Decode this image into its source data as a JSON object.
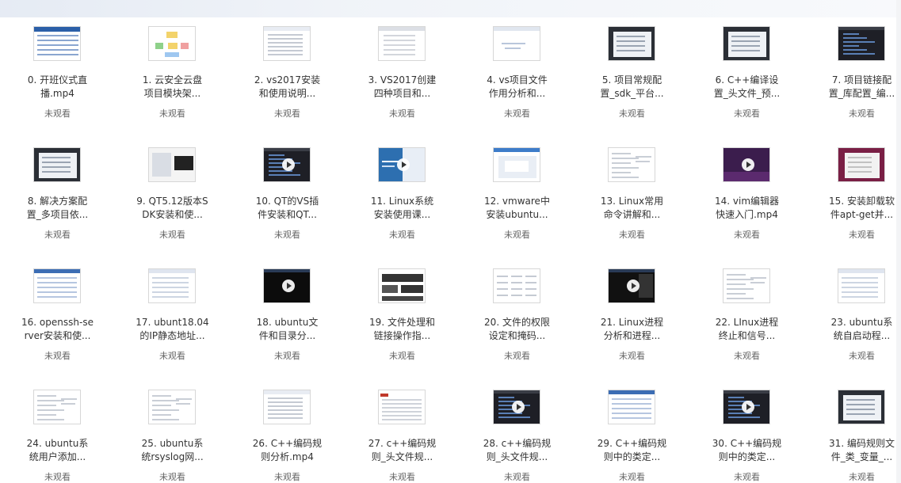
{
  "status_label": "未观看",
  "videos": [
    {
      "title": "0. 开班仪式直\n播.mp4",
      "thumb": "blue-table",
      "play": false
    },
    {
      "title": "1. 云安全云盘\n项目模块架...",
      "thumb": "diagram",
      "play": false
    },
    {
      "title": "2. vs2017安装\n和使用说明...",
      "thumb": "doc-list",
      "play": false
    },
    {
      "title": "3. VS2017创建\n四种项目和...",
      "thumb": "doc-gray",
      "play": false
    },
    {
      "title": "4. vs项目文件\n作用分析和...",
      "thumb": "doc-light",
      "play": false
    },
    {
      "title": "5. 项目常规配\n置_sdk_平台...",
      "thumb": "dialog-dark",
      "play": false
    },
    {
      "title": "6. C++编译设\n置_头文件_预...",
      "thumb": "dialog-dark",
      "play": false
    },
    {
      "title": "7. 项目链接配\n置_库配置_编...",
      "thumb": "ide-dark",
      "play": false
    },
    {
      "title": "8. 解决方案配\n置_多项目依...",
      "thumb": "dialog-dark",
      "play": false
    },
    {
      "title": "9. QT5.12版本S\nDK安装和使...",
      "thumb": "installer",
      "play": false
    },
    {
      "title": "10. QT的VS插\n件安装和QT...",
      "thumb": "ide-dark",
      "play": true
    },
    {
      "title": "11. Linux系统\n安装使用课...",
      "thumb": "slide-blue",
      "play": true
    },
    {
      "title": "12. vmware中\n安装ubuntu...",
      "thumb": "vmware",
      "play": false
    },
    {
      "title": "13. Linux常用\n命令讲解和...",
      "thumb": "doc-text",
      "play": false
    },
    {
      "title": "14. vim编辑器\n快速入门.mp4",
      "thumb": "purple",
      "play": true
    },
    {
      "title": "15. 安装卸载软\n件apt-get并...",
      "thumb": "ubuntu",
      "play": false
    },
    {
      "title": "16. openssh-se\nrver安装和使...",
      "thumb": "web-blue",
      "play": false
    },
    {
      "title": "17. ubunt18.04\n的IP静态地址...",
      "thumb": "web-light",
      "play": false
    },
    {
      "title": "18. ubuntu文\n件和目录分...",
      "thumb": "terminal",
      "play": true
    },
    {
      "title": "19. 文件处理和\n链接操作指...",
      "thumb": "blocks",
      "play": false
    },
    {
      "title": "20. 文件的权限\n设定和掩码...",
      "thumb": "table-text",
      "play": false
    },
    {
      "title": "21. Linux进程\n分析和进程...",
      "thumb": "terminal2",
      "play": true
    },
    {
      "title": "22. LInux进程\n终止和信号...",
      "thumb": "doc-text",
      "play": false
    },
    {
      "title": "23. ubuntu系\n统自启动程...",
      "thumb": "web-light",
      "play": false
    },
    {
      "title": "24. ubuntu系\n统用户添加...",
      "thumb": "doc-text",
      "play": false
    },
    {
      "title": "25. ubuntu系\n统rsyslog网...",
      "thumb": "doc-text",
      "play": false
    },
    {
      "title": "26. C++编码规\n则分析.mp4",
      "thumb": "doc-list",
      "play": false
    },
    {
      "title": "27. c++编码规\n则_头文件规...",
      "thumb": "doc-red",
      "play": false
    },
    {
      "title": "28. c++编码规\n则_头文件规...",
      "thumb": "ide-dark",
      "play": true
    },
    {
      "title": "29. C++编码规\n则中的类定...",
      "thumb": "web-blue",
      "play": false
    },
    {
      "title": "30. C++编码规\n则中的类定...",
      "thumb": "ide-dark",
      "play": true
    },
    {
      "title": "31. 编码规则文\n件_类_变量_...",
      "thumb": "dialog-dark",
      "play": false
    },
    {
      "title": "",
      "thumb": "none",
      "play": false
    }
  ]
}
